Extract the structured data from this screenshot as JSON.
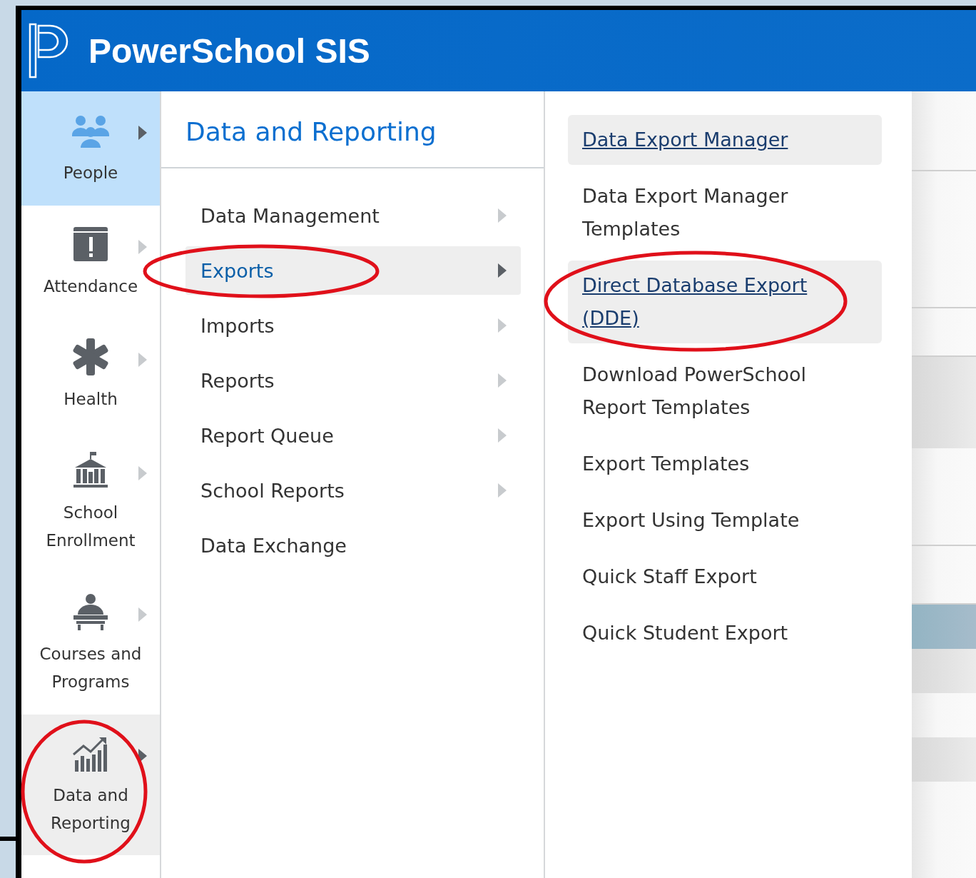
{
  "header": {
    "title": "PowerSchool SIS"
  },
  "sidebar": {
    "items": [
      {
        "label": "People",
        "highlighted": true,
        "selected": false,
        "circled": false
      },
      {
        "label": "Attendance",
        "highlighted": false,
        "selected": false,
        "circled": false
      },
      {
        "label": "Health",
        "highlighted": false,
        "selected": false,
        "circled": false
      },
      {
        "label": "School Enrollment",
        "highlighted": false,
        "selected": false,
        "circled": false
      },
      {
        "label": "Courses and Programs",
        "highlighted": false,
        "selected": false,
        "circled": false
      },
      {
        "label": "Data and Reporting",
        "highlighted": false,
        "selected": true,
        "circled": true
      }
    ]
  },
  "menu": {
    "title": "Data and Reporting",
    "items": [
      {
        "label": "Data Management",
        "has_submenu": true,
        "selected": false,
        "circled": false
      },
      {
        "label": "Exports",
        "has_submenu": true,
        "selected": true,
        "circled": true
      },
      {
        "label": "Imports",
        "has_submenu": true,
        "selected": false,
        "circled": false
      },
      {
        "label": "Reports",
        "has_submenu": true,
        "selected": false,
        "circled": false
      },
      {
        "label": "Report Queue",
        "has_submenu": true,
        "selected": false,
        "circled": false
      },
      {
        "label": "School Reports",
        "has_submenu": true,
        "selected": false,
        "circled": false
      },
      {
        "label": "Data Exchange",
        "has_submenu": false,
        "selected": false,
        "circled": false
      }
    ]
  },
  "submenu": {
    "items": [
      {
        "label": "Data Export Manager",
        "selected": true,
        "circled": false
      },
      {
        "label": "Data Export Manager Templates",
        "selected": false,
        "circled": false
      },
      {
        "label": "Direct Database Export (DDE)",
        "selected": true,
        "circled": true
      },
      {
        "label": "Download PowerSchool Report Templates",
        "selected": false,
        "circled": false
      },
      {
        "label": "Export Templates",
        "selected": false,
        "circled": false
      },
      {
        "label": "Export Using Template",
        "selected": false,
        "circled": false
      },
      {
        "label": "Quick Staff Export",
        "selected": false,
        "circled": false
      },
      {
        "label": "Quick Student Export",
        "selected": false,
        "circled": false
      }
    ]
  }
}
